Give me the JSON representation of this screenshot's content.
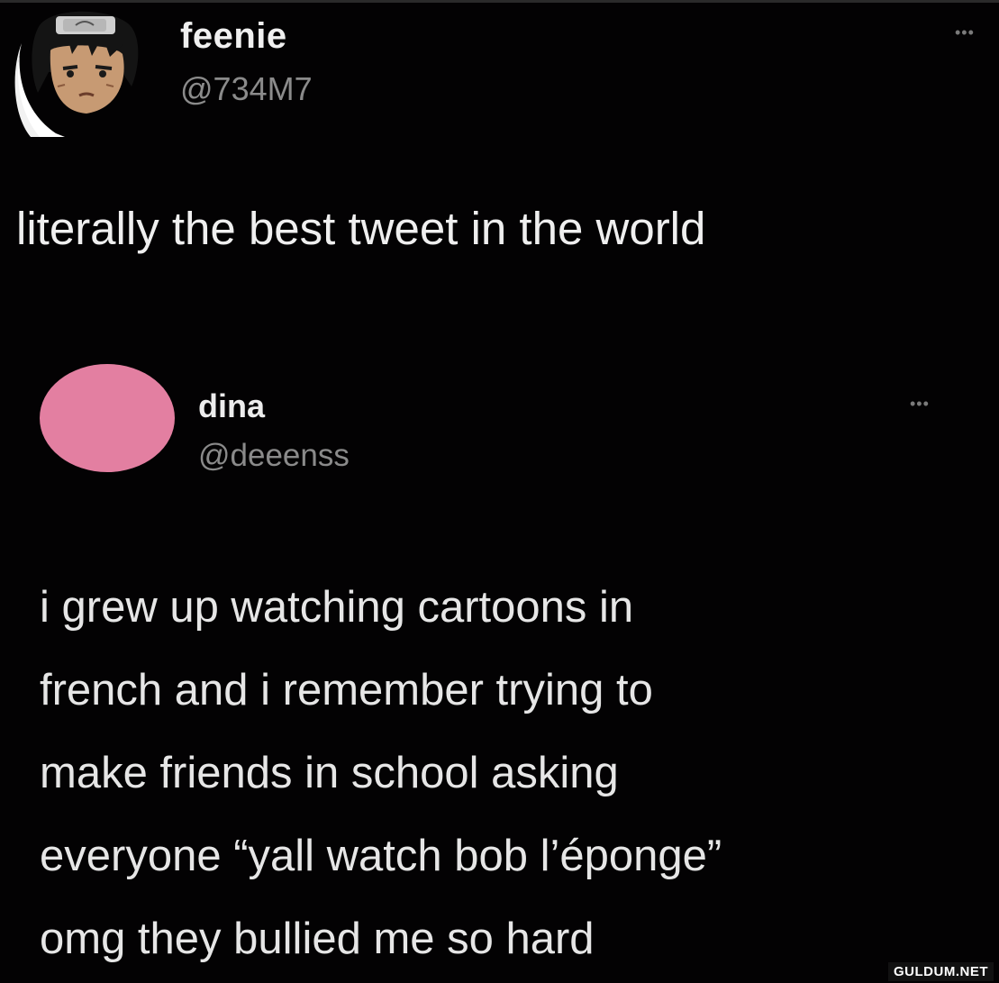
{
  "outer_tweet": {
    "display_name": "feenie",
    "handle": "@734M7",
    "text": "literally the best tweet in the world",
    "more_label": "•••"
  },
  "quoted_tweet": {
    "display_name": "dina",
    "handle": "@deeenss",
    "avatar_color": "#e37fa1",
    "more_label": "•••",
    "text_lines": [
      "i grew up watching cartoons in",
      "french and i remember trying to",
      "make friends in school asking",
      "everyone “yall watch bob l’éponge”",
      "omg they bullied me so hard"
    ]
  },
  "watermark": "GULDUM.NET"
}
